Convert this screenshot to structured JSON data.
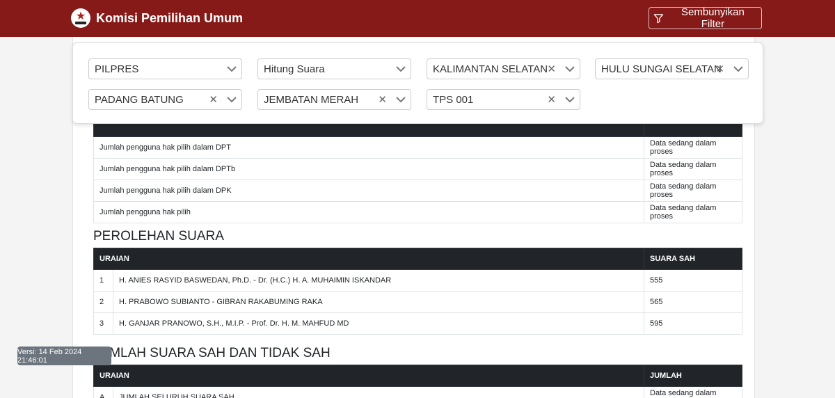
{
  "header": {
    "title": "Komisi Pemilihan Umum",
    "filter_button": "Sembunyikan Filter"
  },
  "filters": [
    {
      "value": "PILPRES",
      "clearable": false
    },
    {
      "value": "Hitung Suara",
      "clearable": false
    },
    {
      "value": "KALIMANTAN SELATAN",
      "clearable": true
    },
    {
      "value": "HULU SUNGAI SELATAN",
      "clearable": true
    },
    {
      "value": "PADANG BATUNG",
      "clearable": true
    },
    {
      "value": "JEMBATAN MERAH",
      "clearable": true
    },
    {
      "value": "TPS 001",
      "clearable": true
    }
  ],
  "voters": {
    "rows": [
      {
        "label": "Jumlah pengguna hak pilih dalam DPT",
        "value": "Data sedang dalam proses"
      },
      {
        "label": "Jumlah pengguna hak pilih dalam DPTb",
        "value": "Data sedang dalam proses"
      },
      {
        "label": "Jumlah pengguna hak pilih dalam DPK",
        "value": "Data sedang dalam proses"
      },
      {
        "label": "Jumlah pengguna hak pilih",
        "value": "Data sedang dalam proses"
      }
    ]
  },
  "perolehan": {
    "title": "PEROLEHAN SUARA",
    "col_uraian": "URAIAN",
    "col_suara": "SUARA SAH",
    "rows": [
      {
        "no": "1",
        "name": "H. ANIES RASYID BASWEDAN, Ph.D. - Dr. (H.C.) H. A. MUHAIMIN ISKANDAR",
        "votes": "555"
      },
      {
        "no": "2",
        "name": "H. PRABOWO SUBIANTO - GIBRAN RAKABUMING RAKA",
        "votes": "565"
      },
      {
        "no": "3",
        "name": "H. GANJAR PRANOWO, S.H., M.I.P. - Prof. Dr. H. M. MAHFUD MD",
        "votes": "595"
      }
    ]
  },
  "jumlah": {
    "title": "JUMLAH SUARA SAH DAN TIDAK SAH",
    "col_uraian": "URAIAN",
    "col_jumlah": "JUMLAH",
    "rows": [
      {
        "no": "A",
        "label": "JUMLAH SELURUH SUARA SAH",
        "value": "Data sedang dalam proses"
      }
    ]
  },
  "version": "Versi: 14 Feb 2024 21:46:01",
  "colors": {
    "brand": "#861a18",
    "table_header": "#212529",
    "version_badge": "#6c757d"
  }
}
